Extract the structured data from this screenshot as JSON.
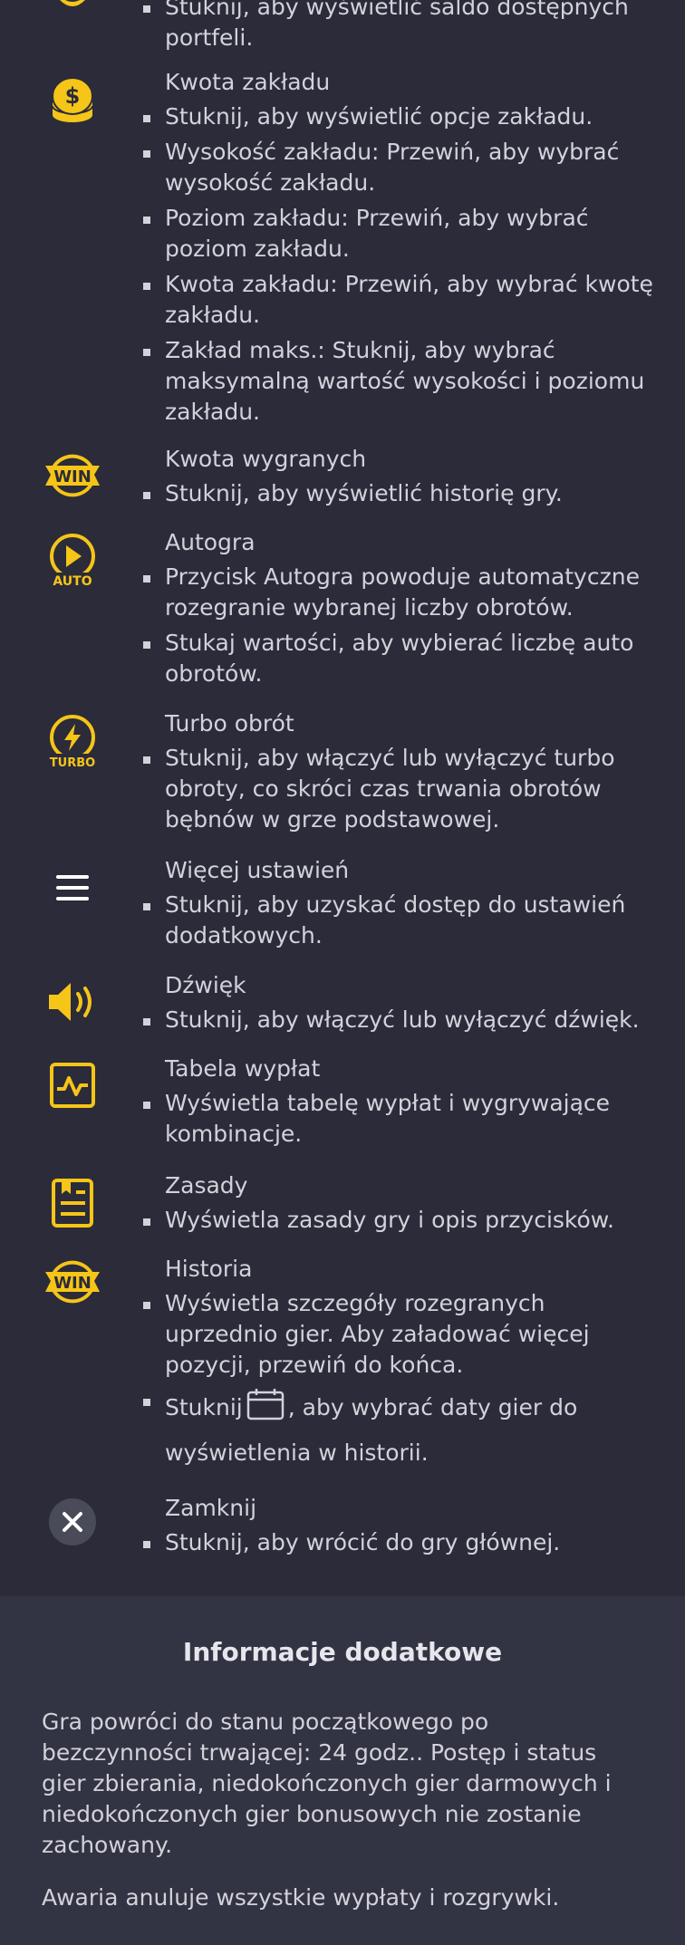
{
  "items": [
    {
      "icon": "wallet-icon",
      "title": "",
      "bullets": [
        "Stuknij, aby wyświetlić saldo dostępnych portfeli."
      ]
    },
    {
      "icon": "coins-icon",
      "title": "Kwota zakładu",
      "bullets": [
        "Stuknij, aby wyświetlić opcje zakładu.",
        "Wysokość zakładu: Przewiń, aby wybrać wysokość zakładu.",
        "Poziom zakładu: Przewiń, aby wybrać poziom zakładu.",
        "Kwota zakładu: Przewiń, aby wybrać kwotę zakładu.",
        "Zakład maks.: Stuknij, aby wybrać maksymalną wartość wysokości i poziomu zakładu."
      ]
    },
    {
      "icon": "win-icon",
      "icon_text": "WIN",
      "title": "Kwota wygranych",
      "bullets": [
        "Stuknij, aby wyświetlić historię gry."
      ]
    },
    {
      "icon": "autoplay-icon",
      "icon_text": "AUTO",
      "title": "Autogra",
      "bullets": [
        "Przycisk Autogra powoduje automatyczne rozegranie wybranej liczby obrotów.",
        "Stukaj wartości, aby wybierać liczbę auto obrotów."
      ]
    },
    {
      "icon": "turbo-icon",
      "icon_text": "TURBO",
      "title": "Turbo obrót",
      "bullets": [
        "Stuknij, aby włączyć lub wyłączyć turbo obroty, co skróci czas trwania obrotów bębnów w grze podstawowej."
      ]
    },
    {
      "icon": "menu-icon",
      "title": "Więcej ustawień",
      "bullets": [
        "Stuknij, aby uzyskać dostęp do ustawień dodatkowych."
      ]
    },
    {
      "icon": "sound-icon",
      "title": "Dźwięk",
      "bullets": [
        "Stuknij, aby włączyć lub wyłączyć dźwięk."
      ]
    },
    {
      "icon": "paytable-icon",
      "title": "Tabela wypłat",
      "bullets": [
        "Wyświetla tabelę wypłat i wygrywające kombinacje."
      ]
    },
    {
      "icon": "rules-icon",
      "title": "Zasady",
      "bullets": [
        "Wyświetla zasady gry i opis przycisków."
      ]
    },
    {
      "icon": "history-icon",
      "icon_text": "WIN",
      "title": "Historia",
      "bullets": [
        "Wyświetla szczegóły rozegranych uprzednio gier. Aby załadować więcej pozycji, przewiń do końca."
      ],
      "calendar_before": "Stuknij",
      "calendar_after": ", aby wybrać daty gier do wyświetlenia w historii."
    },
    {
      "icon": "close-icon",
      "title": "Zamknij",
      "bullets": [
        "Stuknij, aby wrócić do gry głównej."
      ]
    }
  ],
  "extra": {
    "title": "Informacje dodatkowe",
    "paragraphs": [
      "Gra powróci do stanu początkowego po bezczynności trwającej: 24 godz.. Postęp i status gier zbierania, niedokończonych gier darmowych i niedokończonych gier bonusowych nie zostanie zachowany.",
      "Awaria anuluje wszystkie wypłaty i rozgrywki."
    ]
  },
  "colors": {
    "accent": "#f5c518",
    "background": "#2b2b3a",
    "panel": "#323343",
    "text": "#d2d2da"
  }
}
